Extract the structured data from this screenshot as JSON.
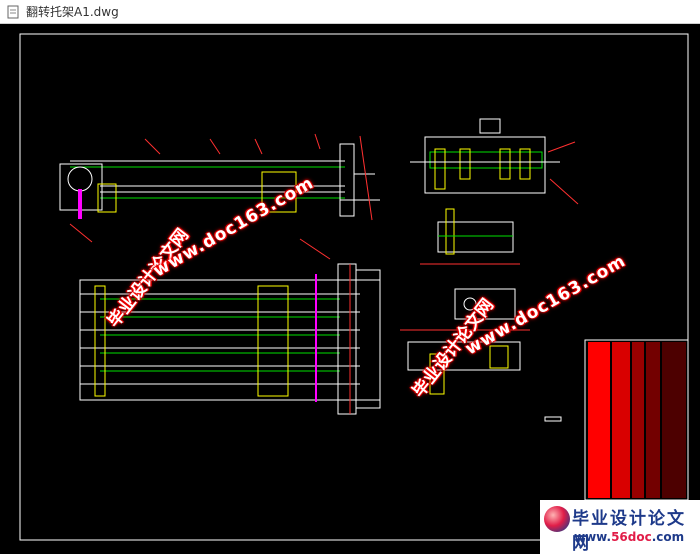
{
  "window": {
    "title": "翻转托架A1.dwg",
    "icon": "document-icon"
  },
  "drawing": {
    "background": "#000000",
    "colors": {
      "frame": "#ffffff",
      "outline": "#ffffff",
      "centerline": "#ff3030",
      "detail_green": "#00e000",
      "detail_yellow": "#ffff00",
      "magenta": "#ff00ff",
      "cyan": "#00ffff",
      "title_block_red": "#ff0000"
    }
  },
  "watermarks": {
    "cn_text": "毕业设计论文网",
    "url_text": "www.doc163.com"
  },
  "badge": {
    "brand": "毕业设计论文网",
    "site_prefix": "www.",
    "site_mid": "56doc",
    "site_suffix": ".com"
  }
}
